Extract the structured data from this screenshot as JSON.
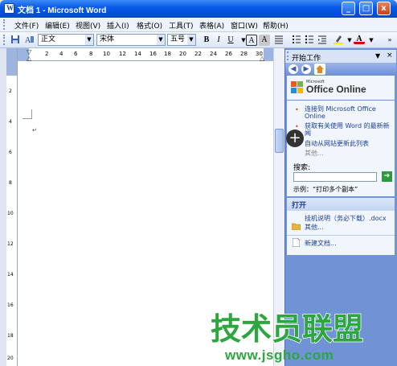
{
  "window": {
    "title": "文档 1 - Microsoft Word",
    "minimize_label": "_",
    "maximize_label": "□",
    "close_label": "x"
  },
  "menubar": {
    "items": [
      "文件(F)",
      "编辑(E)",
      "视图(V)",
      "插入(I)",
      "格式(O)",
      "工具(T)",
      "表格(A)",
      "窗口(W)",
      "帮助(H)"
    ]
  },
  "toolbar": {
    "style_value": "正文",
    "font_value": "宋体",
    "size_value": "五号",
    "bold_label": "B",
    "italic_label": "I",
    "underline_label": "U",
    "char_border_label": "A",
    "char_shade_label": "A",
    "font_color_label": "A"
  },
  "ruler": {
    "ticks": [
      "2",
      "4",
      "6",
      "8",
      "10",
      "12",
      "14",
      "16",
      "18",
      "20",
      "22",
      "24",
      "26",
      "28",
      "30"
    ],
    "vticks": [
      "2",
      "4",
      "6",
      "8",
      "10",
      "12",
      "14",
      "16",
      "18",
      "20"
    ]
  },
  "document": {
    "paragraph_mark": "↵"
  },
  "taskpane": {
    "title": "开始工作",
    "office_online_small": "Microsoft",
    "office_online": "Office Online",
    "links": [
      "连接到 Microsoft Office Online",
      "获取有关使用 Word 的最新新闻",
      "自动从网站更新此列表"
    ],
    "more_label": "其他...",
    "search_label": "搜索:",
    "search_value": "",
    "example_label": "示例：“打印多个副本”",
    "open_section_title": "打开",
    "open_files": [
      "挂机说明（务必下载）.docx"
    ],
    "open_more_label": "其他...",
    "new_doc_label": "新建文档..."
  },
  "watermark": {
    "text": "技术员联盟",
    "url": "www.jsgho.com"
  },
  "colors": {
    "titlebar": "#0a5ce8",
    "taskpane_bg": "#6f93d4",
    "watermark_green": "#2da63f"
  }
}
